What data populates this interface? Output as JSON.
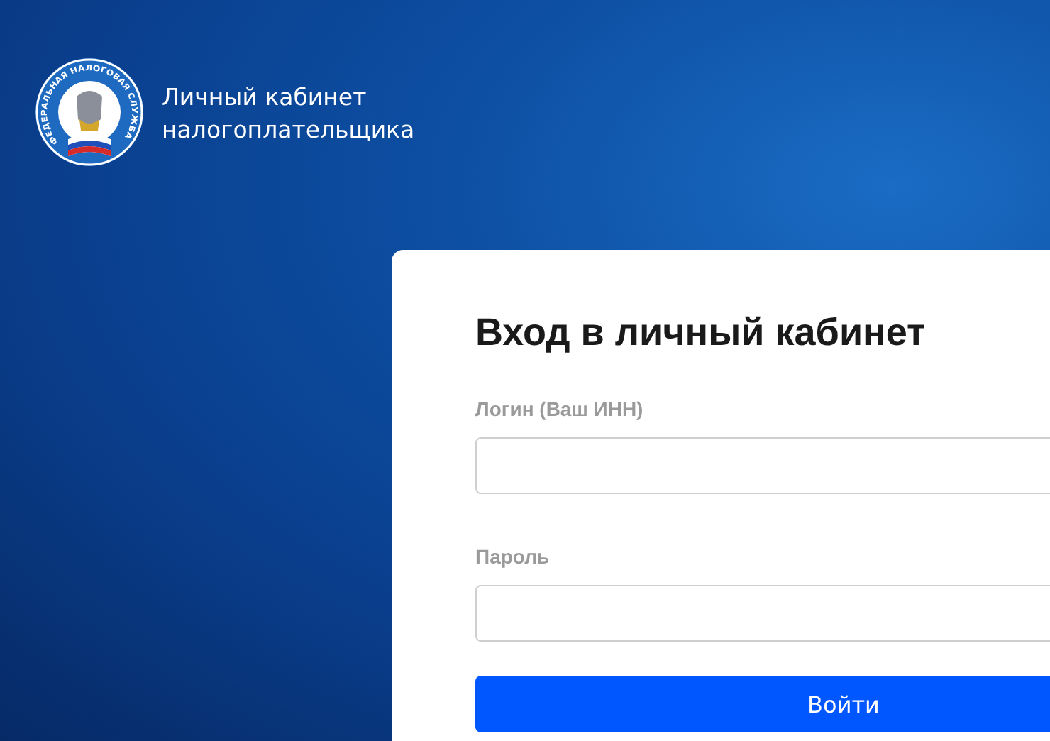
{
  "header": {
    "emblem_text": "ФЕДЕРАЛЬНАЯ НАЛОГОВАЯ СЛУЖБА",
    "title_lines": [
      "Личный кабинет",
      "налогоплательщика"
    ]
  },
  "login": {
    "heading": "Вход в личный кабинет",
    "fields": [
      {
        "label": "Логин (Ваш ИНН)"
      },
      {
        "label": "Пароль"
      }
    ],
    "button": "Войти"
  }
}
